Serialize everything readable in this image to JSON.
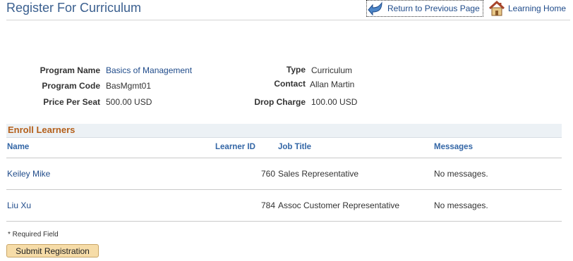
{
  "header": {
    "title": "Register For Curriculum",
    "return_label": "Return to Previous Page",
    "home_label": "Learning Home"
  },
  "program": {
    "program_name_label": "Program Name",
    "program_name_value": "Basics of Management",
    "program_code_label": "Program Code",
    "program_code_value": "BasMgmt01",
    "price_label": "Price Per Seat",
    "price_value": "500.00 USD",
    "type_label": "Type",
    "type_value": "Curriculum",
    "contact_label": "Contact",
    "contact_value": "Allan Martin",
    "drop_charge_label": "Drop Charge",
    "drop_charge_value": "100.00 USD"
  },
  "enroll": {
    "section_title": "Enroll Learners",
    "columns": {
      "name": "Name",
      "learner_id": "Learner ID",
      "job_title": "Job Title",
      "messages": "Messages"
    },
    "rows": [
      {
        "name": "Keiley Mike",
        "learner_id": "760",
        "job_title": "Sales Representative",
        "messages": "No messages."
      },
      {
        "name": "Liu Xu",
        "learner_id": "784",
        "job_title": "Assoc Customer Representative",
        "messages": "No messages."
      }
    ]
  },
  "footer": {
    "required_note": "* Required Field",
    "submit_label": "Submit Registration"
  },
  "icons": {
    "return": "return-arrow-icon",
    "home": "house-icon"
  },
  "colors": {
    "title": "#3a5f8f",
    "link": "#1f4b8a",
    "section_title": "#b45f1a",
    "button": "#f6dca8"
  }
}
